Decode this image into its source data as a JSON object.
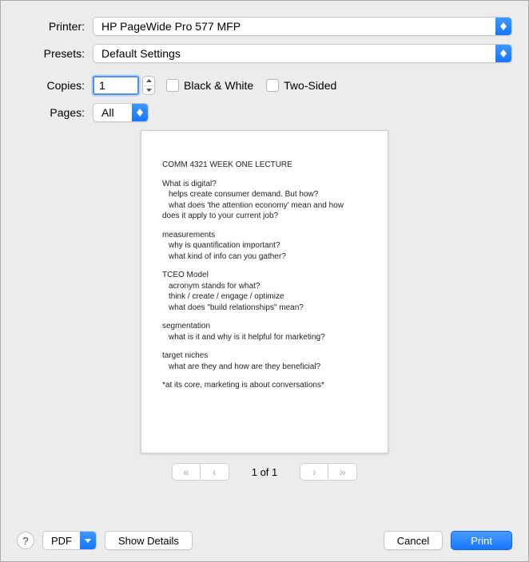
{
  "labels": {
    "printer": "Printer:",
    "presets": "Presets:",
    "copies": "Copies:",
    "pages": "Pages:"
  },
  "printer": {
    "selected": "HP PageWide Pro 577 MFP"
  },
  "presets": {
    "selected": "Default Settings"
  },
  "copies": {
    "value": "1"
  },
  "checkboxes": {
    "black_white": "Black & White",
    "two_sided": "Two-Sided"
  },
  "pages": {
    "selected": "All"
  },
  "preview": {
    "title": "COMM 4321 WEEK ONE LECTURE",
    "s1h": "What is digital?",
    "s1a": "helps create consumer demand. But how?",
    "s1b": "what does 'the attention economy' mean and how",
    "s1c": "does it apply to your current job?",
    "s2h": "measurements",
    "s2a": "why is quantification important?",
    "s2b": "what kind of info can you gather?",
    "s3h": "TCEO Model",
    "s3a": "acronym stands for what?",
    "s3b": "think / create / engage / optimize",
    "s3c": "what does \"build relationships\" mean?",
    "s4h": "segmentation",
    "s4a": "what is it and why is it helpful for marketing?",
    "s5h": "target niches",
    "s5a": "what are they and how are they beneficial?",
    "s6": "*at its core, marketing is about conversations*"
  },
  "pager": {
    "count": "1 of 1"
  },
  "footer": {
    "pdf": "PDF",
    "show_details": "Show Details",
    "cancel": "Cancel",
    "print": "Print"
  }
}
